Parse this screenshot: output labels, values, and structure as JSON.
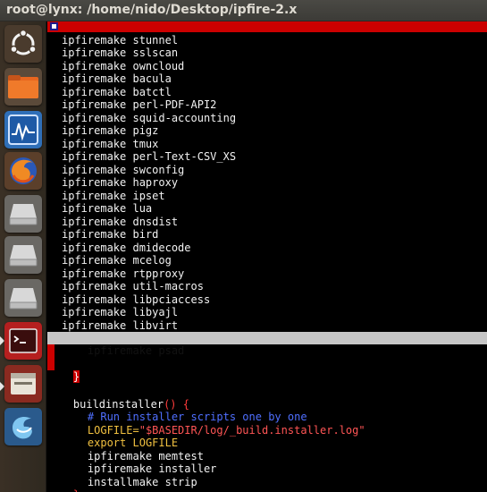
{
  "window": {
    "title": "root@lynx: /home/nido/Desktop/ipfire-2.x"
  },
  "launcher": {
    "items": [
      {
        "name": "ubuntu-dash-icon"
      },
      {
        "name": "files-icon"
      },
      {
        "name": "system-monitor-icon"
      },
      {
        "name": "firefox-icon"
      },
      {
        "name": "drive-icon-1"
      },
      {
        "name": "drive-icon-2"
      },
      {
        "name": "drive-icon-3"
      },
      {
        "name": "terminal-icon"
      },
      {
        "name": "file-manager-icon"
      },
      {
        "name": "app-icon"
      }
    ],
    "colors": {
      "background": "#3a3025",
      "accent": "#cc0000"
    }
  },
  "terminal": {
    "colors": {
      "background": "#000000",
      "highlight": "#c6c6c6",
      "red": "#cc0000",
      "comment": "#4f6fff",
      "variable": "#f0c040"
    },
    "make_lines": [
      "ipfiremake stunnel",
      "ipfiremake sslscan",
      "ipfiremake owncloud",
      "ipfiremake bacula",
      "ipfiremake batctl",
      "ipfiremake perl-PDF-API2",
      "ipfiremake squid-accounting",
      "ipfiremake pigz",
      "ipfiremake tmux",
      "ipfiremake perl-Text-CSV_XS",
      "ipfiremake swconfig",
      "ipfiremake haproxy",
      "ipfiremake ipset",
      "ipfiremake lua",
      "ipfiremake dnsdist",
      "ipfiremake bird",
      "ipfiremake dmidecode",
      "ipfiremake mcelog",
      "ipfiremake rtpproxy",
      "ipfiremake util-macros",
      "ipfiremake libpciaccess",
      "ipfiremake libyajl",
      "ipfiremake libvirt"
    ],
    "highlighted_line": "ipfiremake psad",
    "closing_brace": "}",
    "function_name": "buildinstaller",
    "function_parens": "()",
    "function_open": " {",
    "comment": "# Run installer scripts one by one",
    "logfile_key": "LOGFILE=",
    "logfile_quote_open": "\"",
    "logfile_var": "$BASEDIR",
    "logfile_path": "/log/_build.installer.log",
    "logfile_quote_close": "\"",
    "export_kw": "export",
    "export_var": " LOGFILE",
    "body_lines": [
      "ipfiremake memtest",
      "ipfiremake installer",
      "installmake strip"
    ],
    "final_brace": "}"
  }
}
